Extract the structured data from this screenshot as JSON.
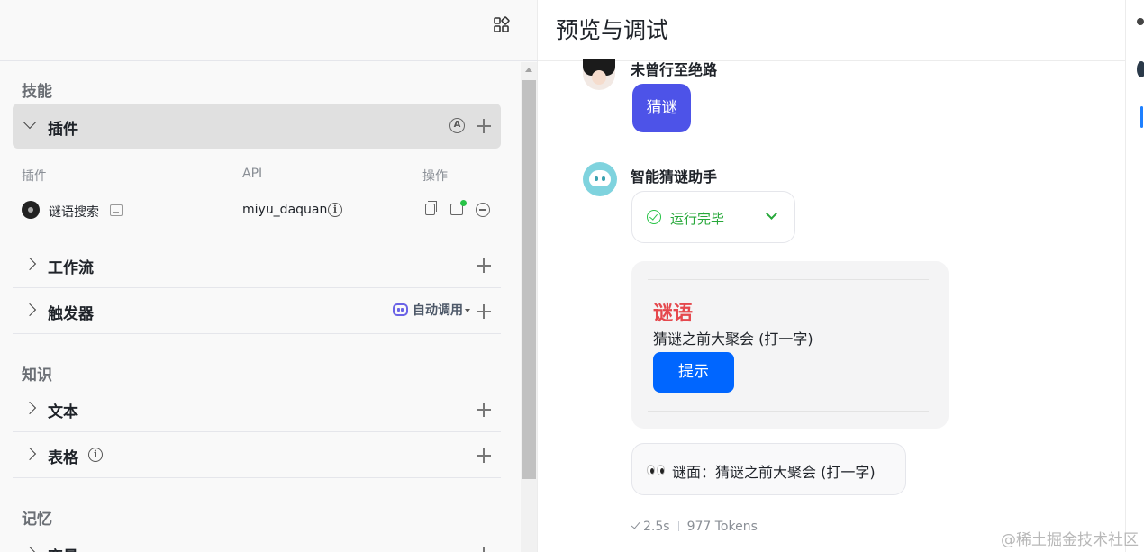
{
  "left": {
    "skills_title": "技能",
    "plugin_header": "插件",
    "plugin_cols": {
      "plugin": "插件",
      "api": "API",
      "ops": "操作"
    },
    "plugin_item": {
      "name": "谜语搜索",
      "api": "miyu_daquan"
    },
    "workflow": "工作流",
    "trigger": "触发器",
    "knowledge_title": "知识",
    "auto_call": "自动调用",
    "text": "文本",
    "table": "表格",
    "memory_title": "记忆",
    "variable": "变量"
  },
  "right": {
    "title": "预览与调试",
    "user_name": "未曾行至绝路",
    "user_message": "猜谜",
    "bot_name": "智能猜谜助手",
    "status": "运行完毕",
    "riddle_title": "谜语",
    "riddle_text": "猜谜之前大聚会 (打一字)",
    "hint_button": "提示",
    "mianmian": "谜面：猜谜之前大聚会 (打一字)",
    "time": "2.5s",
    "tokens": "977 Tokens"
  },
  "watermark": "@稀土掘金技术社区"
}
